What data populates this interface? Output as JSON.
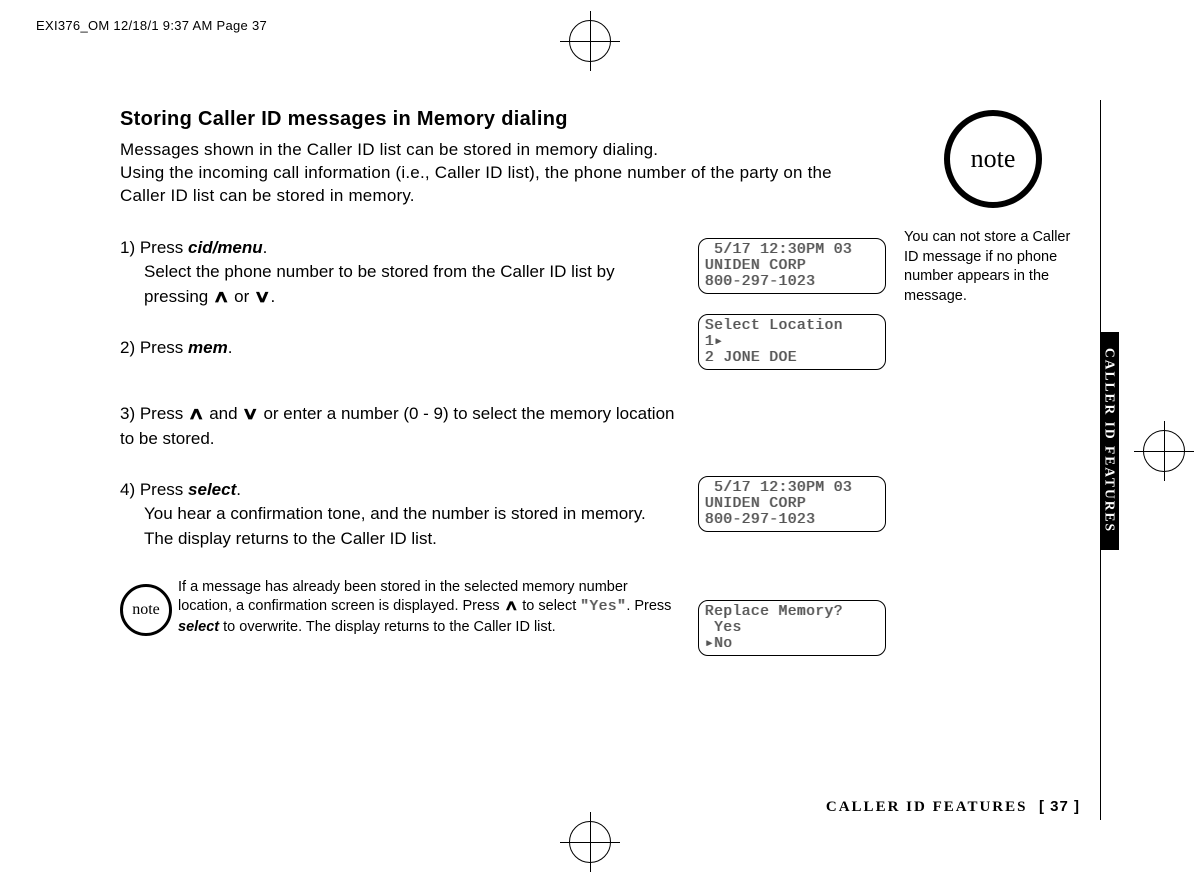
{
  "header": "EXI376_OM  12/18/1 9:37 AM  Page 37",
  "title": "Storing Caller ID messages in Memory dialing",
  "intro_l1": "Messages shown in the Caller ID list can be stored in memory dialing.",
  "intro_l2": "Using the incoming call information (i.e., Caller ID list), the phone number of the party on the Caller ID list can be stored in memory.",
  "step1_a": "1) Press ",
  "step1_kw": "cid/menu",
  "step1_b": ".",
  "step1_c": "Select the phone number to be stored from the Caller ID list by pressing ",
  "step1_d": " or ",
  "step1_e": ".",
  "step2_a": "2) Press ",
  "step2_kw": "mem",
  "step2_b": ".",
  "step3_a": "3) Press ",
  "step3_b": " and ",
  "step3_c": " or enter a number (0 - 9) to select the memory location to be stored.",
  "step4_a": "4) Press ",
  "step4_kw": "select",
  "step4_b": ".",
  "step4_c": "You hear a confirmation tone, and the number is stored in memory.",
  "step4_d": "The display returns to the Caller ID list.",
  "note_inline_a": "If a message has already been stored in the selected memory number location, a confirmation screen is displayed. Press ",
  "note_inline_b": " to select ",
  "note_inline_yes": "\"Yes\"",
  "note_inline_c": ". Press ",
  "note_inline_kw": "select",
  "note_inline_d": " to overwrite. The display returns to the Caller ID list.",
  "note_label": "note",
  "side_note": "You can not store a Caller ID message if no phone number appears in the message.",
  "side_tab": "CALLER ID FEATURES",
  "footer_section": "CALLER ID FEATURES",
  "footer_page": "[ 37 ]",
  "lcd1": " 5/17 12:30PM 03\nUNIDEN CORP\n800-297-1023",
  "lcd2": "Select Location\n1▸\n2 JONE DOE",
  "lcd3": " 5/17 12:30PM 03\nUNIDEN CORP\n800-297-1023",
  "lcd4": "Replace Memory?\n Yes\n▸No",
  "arrow_up": "∧",
  "arrow_down": "∨"
}
